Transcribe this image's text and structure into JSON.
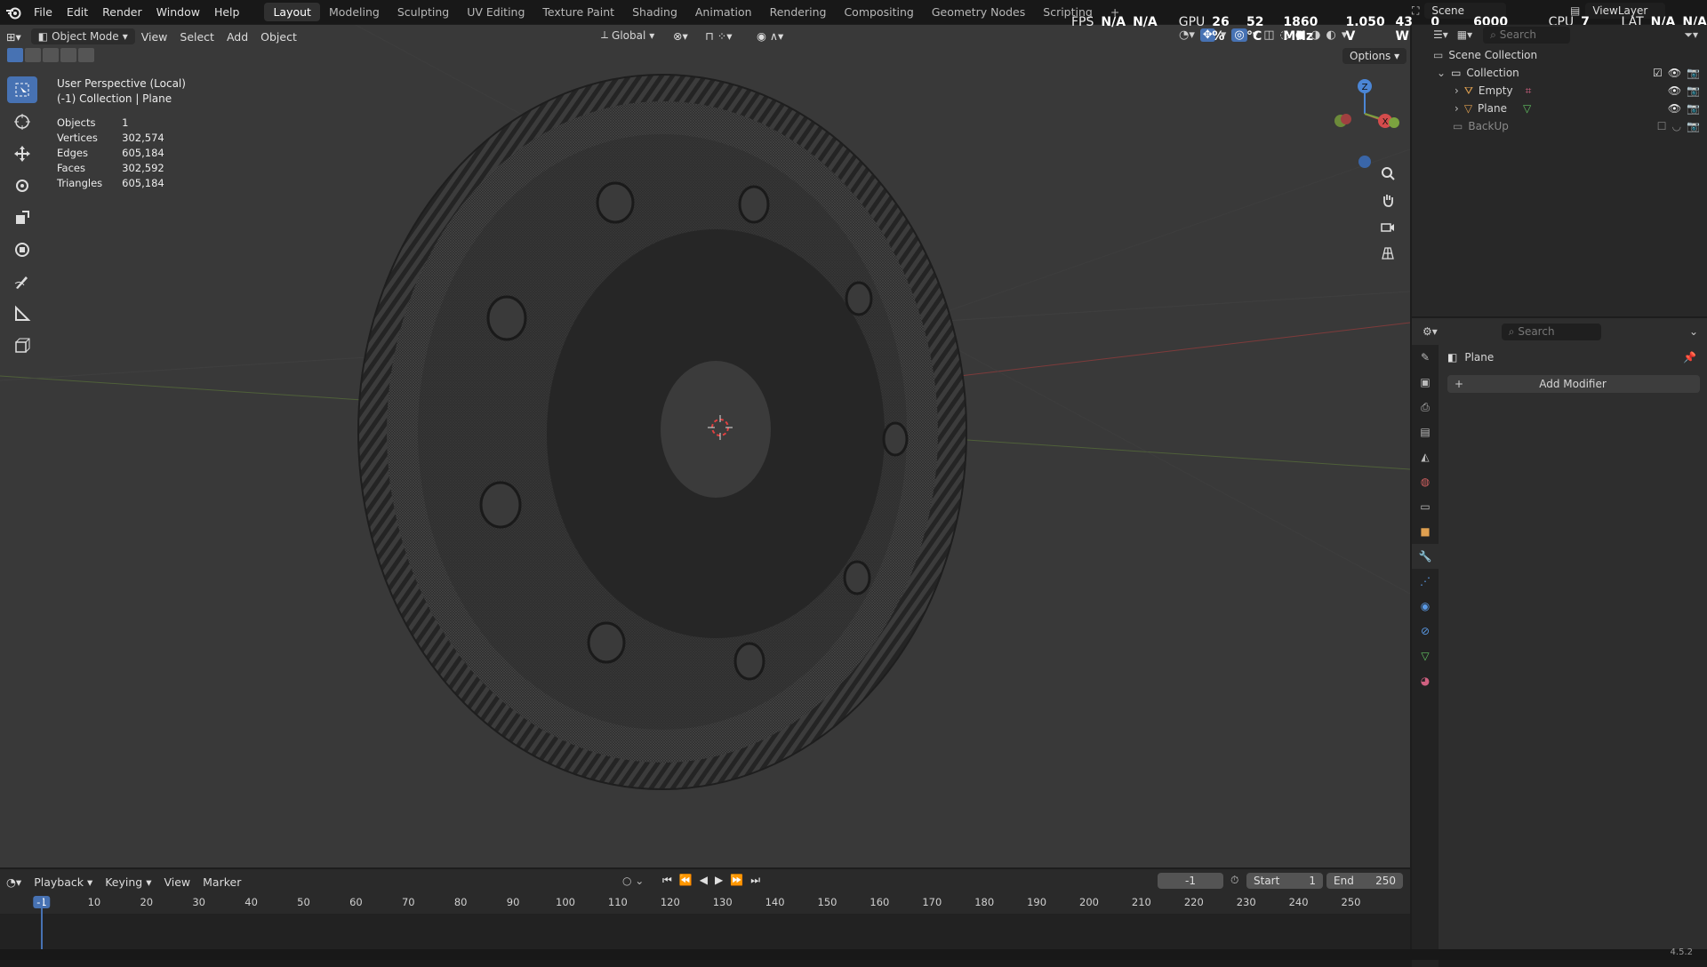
{
  "menu": [
    "File",
    "Edit",
    "Render",
    "Window",
    "Help"
  ],
  "workspaces": [
    "Layout",
    "Modeling",
    "Sculpting",
    "UV Editing",
    "Texture Paint",
    "Shading",
    "Animation",
    "Rendering",
    "Compositing",
    "Geometry Nodes",
    "Scripting",
    "+"
  ],
  "active_workspace": "Layout",
  "scene": {
    "label": "Scene",
    "view_layer": "ViewLayer"
  },
  "perf": {
    "fps_label": "FPS",
    "fps1": "N/A",
    "fps2": "N/A",
    "gpu_label": "GPU",
    "gpu_load": "26 %",
    "gpu_temp": "52 °C",
    "gpu_clock": "1860 MHz",
    "gpu_volt": "1.050 V",
    "gpu_power": "43 W",
    "gpu_rpm": "0 RPM",
    "gpu_mem": "6000 MHz",
    "cpu_label": "CPU",
    "cpu_load": "7 %",
    "lat_label": "LAT",
    "lat1": "N/A",
    "lat2": "N/A"
  },
  "viewport": {
    "mode": "Object Mode",
    "menus": [
      "View",
      "Select",
      "Add",
      "Object"
    ],
    "transform": "Global",
    "options": "Options",
    "view_name": "User Perspective (Local)",
    "collection_line": "(-1) Collection | Plane",
    "stats": [
      {
        "label": "Objects",
        "value": "1"
      },
      {
        "label": "Vertices",
        "value": "302,574"
      },
      {
        "label": "Edges",
        "value": "605,184"
      },
      {
        "label": "Faces",
        "value": "302,592"
      },
      {
        "label": "Triangles",
        "value": "605,184"
      }
    ],
    "gizmo": {
      "z": "Z",
      "x": "X"
    }
  },
  "outliner": {
    "search_placeholder": "Search",
    "scene_collection": "Scene Collection",
    "collection": "Collection",
    "items": [
      "Empty",
      "Plane"
    ],
    "backup": "BackUp"
  },
  "properties": {
    "search_placeholder": "Search",
    "object_name": "Plane",
    "add_modifier": "Add Modifier"
  },
  "timeline": {
    "menus": [
      "Playback",
      "Keying",
      "View",
      "Marker"
    ],
    "current_frame": "-1",
    "start_label": "Start",
    "start": "1",
    "end_label": "End",
    "end": "250",
    "ticks": [
      "-1",
      "10",
      "20",
      "30",
      "40",
      "50",
      "60",
      "70",
      "80",
      "90",
      "100",
      "110",
      "120",
      "130",
      "140",
      "150",
      "160",
      "170",
      "180",
      "190",
      "200",
      "210",
      "220",
      "230",
      "240",
      "250"
    ]
  },
  "version": "4.5.2",
  "colors": {
    "accent": "#4772b3",
    "x_axis": "#d44c4c",
    "y_axis": "#7ba23f",
    "z_axis": "#4b86d6"
  }
}
